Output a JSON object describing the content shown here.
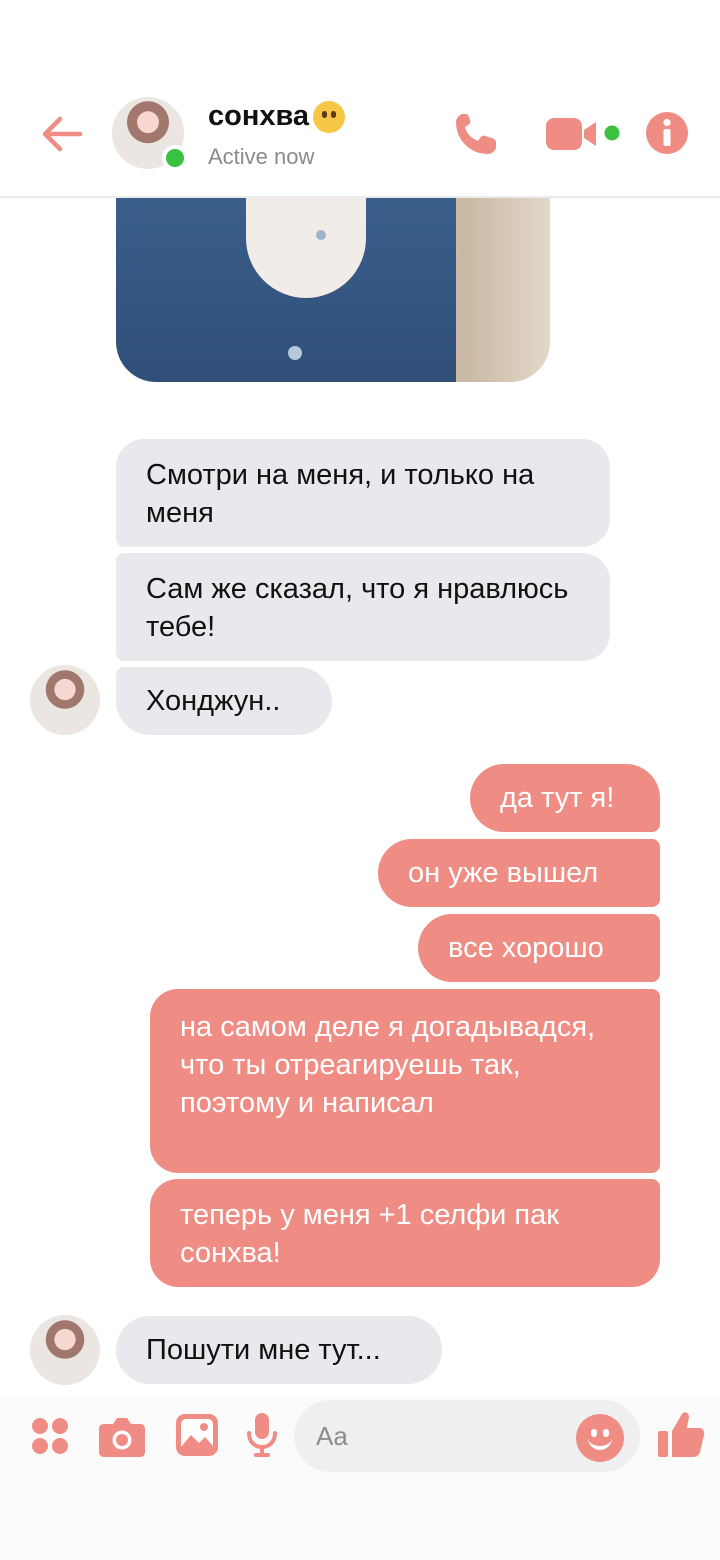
{
  "header": {
    "contact_name": "сонхва",
    "status": "Active now",
    "name_emoji": "no-mouth-emoji",
    "accent_color": "#ef8d85",
    "online_color": "#3bc141"
  },
  "messages": [
    {
      "direction": "incoming",
      "text": "Смотри на меня, и только на меня"
    },
    {
      "direction": "incoming",
      "text": "Сам же сказал, что я нравлюсь тебе!"
    },
    {
      "direction": "incoming",
      "text": "Хонджун.."
    },
    {
      "direction": "outgoing",
      "text": "да тут я!"
    },
    {
      "direction": "outgoing",
      "text": "он уже вышел"
    },
    {
      "direction": "outgoing",
      "text": "все хорошо"
    },
    {
      "direction": "outgoing",
      "text": "на самом деле я догадывадся, что ты отреагируешь так, поэтому и написал"
    },
    {
      "direction": "outgoing",
      "text": "теперь у меня +1 селфи пак сонхва!"
    },
    {
      "direction": "incoming",
      "text": "Пошути мне тут..."
    }
  ],
  "composer": {
    "placeholder": "Aa",
    "icons": [
      "apps-icon",
      "camera-icon",
      "gallery-icon",
      "microphone-icon",
      "emoji-icon",
      "thumbs-up-icon"
    ]
  },
  "colors": {
    "incoming_bubble": "#e9e8ed",
    "outgoing_bubble": "#ef8d85"
  }
}
